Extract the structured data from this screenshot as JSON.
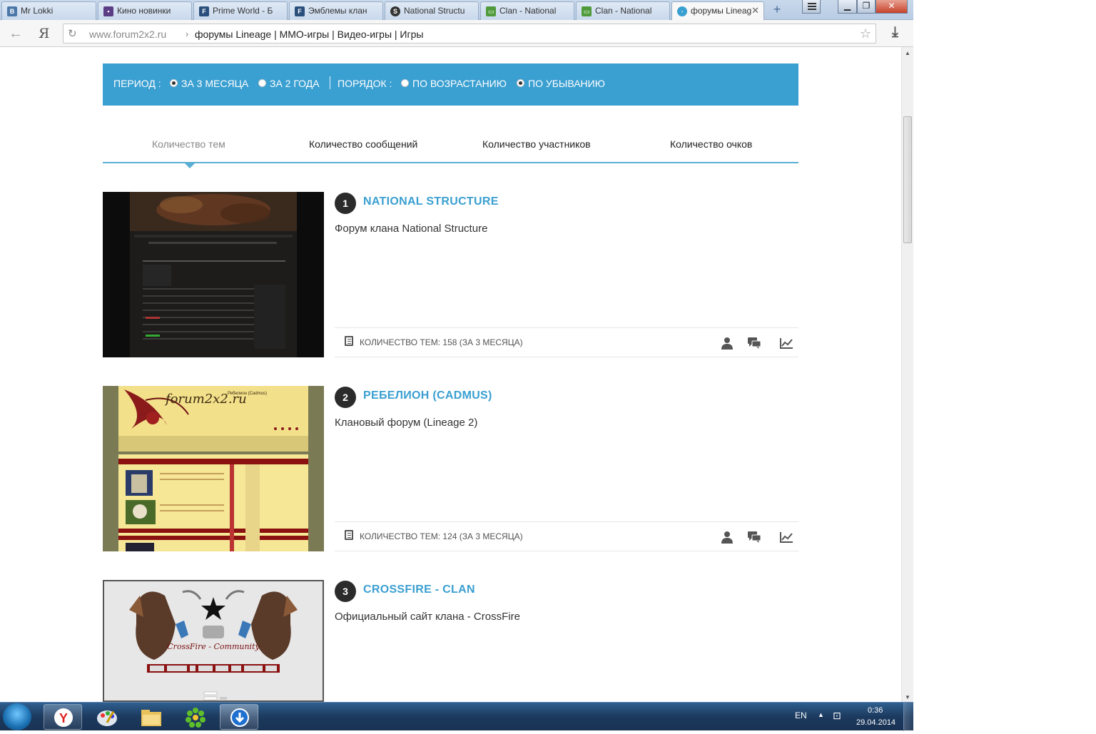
{
  "browser": {
    "tabs": [
      {
        "label": "Mr Lokki",
        "icon": "vk-icon",
        "color": "#4a76a8"
      },
      {
        "label": "Кино новинки",
        "icon": "forum-icon",
        "color": "#5b3d86"
      },
      {
        "label": "Prime World - Б",
        "icon": "forum-icon",
        "color": "#2a4f7c"
      },
      {
        "label": "Эмблемы клан",
        "icon": "forum-icon",
        "color": "#2a4f7c"
      },
      {
        "label": "National Structu",
        "icon": "globe-icon",
        "color": "#333333"
      },
      {
        "label": "Clan - National",
        "icon": "chat-icon",
        "color": "#4f9a3a"
      },
      {
        "label": "Clan - National",
        "icon": "chat-icon",
        "color": "#4f9a3a"
      },
      {
        "label": "форумы Lineag",
        "icon": "forum2x2-icon",
        "color": "#3a9fd1"
      }
    ],
    "url_domain": "www.forum2x2.ru",
    "url_separator": "›",
    "page_title": "форумы Lineage | MMO-игры | Видео-игры | Игры",
    "ya_label": "Я",
    "close_glyph": "✕",
    "new_tab_glyph": "+"
  },
  "filter": {
    "period_label": "ПЕРИОД :",
    "period_options": [
      {
        "label": "ЗА 3 МЕСЯЦА",
        "selected": true
      },
      {
        "label": "ЗА 2 ГОДА",
        "selected": false
      }
    ],
    "order_label": "ПОРЯДОК :",
    "order_options": [
      {
        "label": "ПО ВОЗРАСТАНИЮ",
        "selected": false
      },
      {
        "label": "ПО УБЫВАНИЮ",
        "selected": true
      }
    ]
  },
  "sort_tabs": [
    {
      "label": "Количество тем",
      "active": true
    },
    {
      "label": "Количество сообщений",
      "active": false
    },
    {
      "label": "Количество участников",
      "active": false
    },
    {
      "label": "Количество очков",
      "active": false
    }
  ],
  "forums": [
    {
      "rank": "1",
      "title": "NATIONAL STRUCTURE",
      "description": "Форум клана National Structure",
      "stat": "КОЛИЧЕСТВО ТЕМ: 158 (ЗА 3 МЕСЯЦА)"
    },
    {
      "rank": "2",
      "title": "РЕБЕЛИОН (CADMUS)",
      "description": "Клановый форум (Lineage 2)",
      "stat": "КОЛИЧЕСТВО ТЕМ: 124 (ЗА 3 МЕСЯЦА)"
    },
    {
      "rank": "3",
      "title": "CROSSFIRE - CLAN",
      "description": "Официальный сайт клана - CrossFire",
      "stat": ""
    }
  ],
  "thumb_texts": {
    "forum2": "Ребелион (Cadmus)",
    "forum2_logo": "forum2x2.ru",
    "forum3_logo": "CrossFire - Community"
  },
  "taskbar": {
    "lang": "EN",
    "time": "0:36",
    "date": "29.04.2014"
  },
  "colors": {
    "accent": "#3a9fd1",
    "rank_badge": "#2b2b2b"
  }
}
